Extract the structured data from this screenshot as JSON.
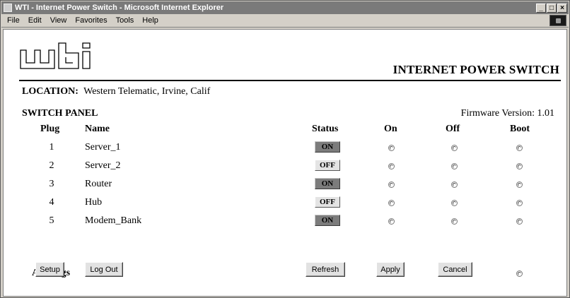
{
  "window": {
    "title": "WTI - Internet Power Switch - Microsoft Internet Explorer",
    "controls": [
      "_",
      "□",
      "×"
    ]
  },
  "menu": [
    "File",
    "Edit",
    "View",
    "Favorites",
    "Tools",
    "Help"
  ],
  "header": {
    "logo_text": "wti",
    "title": "INTERNET POWER SWITCH"
  },
  "location": {
    "label": "LOCATION:",
    "value": "Western Telematic, Irvine, Calif"
  },
  "panel": {
    "title": "SWITCH PANEL",
    "firmware": "Firmware Version: 1.01",
    "columns": {
      "plug": "Plug",
      "name": "Name",
      "status": "Status",
      "on": "On",
      "off": "Off",
      "boot": "Boot"
    },
    "plugs": [
      {
        "number": "1",
        "name": "Server_1",
        "status": "ON"
      },
      {
        "number": "2",
        "name": "Server_2",
        "status": "OFF"
      },
      {
        "number": "3",
        "name": "Router",
        "status": "ON"
      },
      {
        "number": "4",
        "name": "Hub",
        "status": "OFF"
      },
      {
        "number": "5",
        "name": "Modem_Bank",
        "status": "ON"
      }
    ],
    "all_plugs_label": "All Plugs"
  },
  "buttons": {
    "setup": "Setup",
    "logout": "Log Out",
    "refresh": "Refresh",
    "apply": "Apply",
    "cancel": "Cancel"
  },
  "colors": {
    "status_on_bg": "#7c7c7c",
    "status_off_bg": "#e4e4e4",
    "titlebar_bg": "#7a7a7a"
  }
}
